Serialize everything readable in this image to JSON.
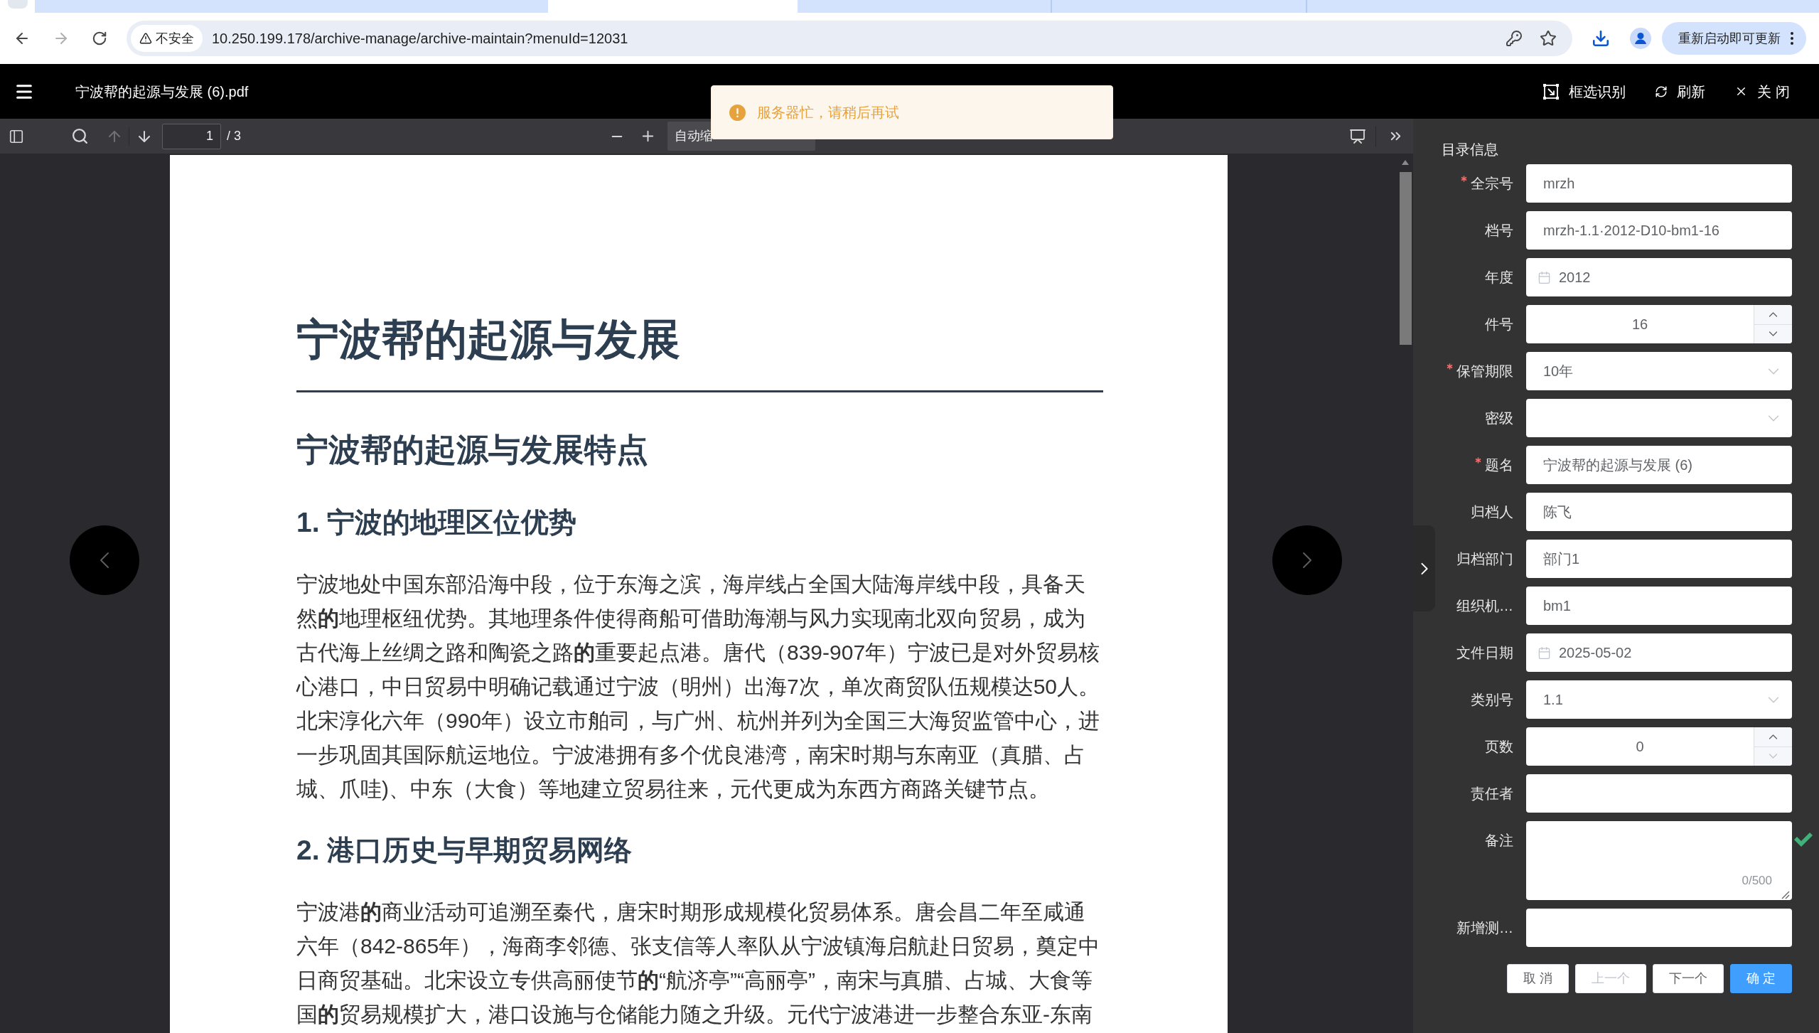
{
  "browser": {
    "tabs": [
      {
        "selected": false
      },
      {
        "selected": true
      },
      {
        "selected": false
      },
      {
        "selected": false
      },
      {
        "selected": false
      }
    ],
    "back_enabled": true,
    "forward_enabled": false,
    "security_label": "不安全",
    "url": "10.250.199.178/archive-manage/archive-maintain?menuId=12031",
    "update_label": "重新启动即可更新"
  },
  "header": {
    "title": "宁波帮的起源与发展 (6).pdf",
    "actions": [
      {
        "kind": "select-area",
        "label": "框选识别"
      },
      {
        "kind": "refresh",
        "label": "刷新"
      },
      {
        "kind": "close",
        "label": "关 闭"
      }
    ]
  },
  "toast": {
    "kind": "warning",
    "message": "服务器忙，请稍后再试"
  },
  "pdf_toolbar": {
    "page": "1",
    "page_total": "/ 3",
    "previous_disabled": true,
    "next_disabled": false,
    "zoom": "自动缩"
  },
  "document": {
    "title": "宁波帮的起源与发展",
    "blocks": [
      {
        "kind": "section",
        "text": "宁波帮的起源与发展特点"
      },
      {
        "kind": "subsection",
        "text": "1. 宁波的地理区位优势"
      },
      {
        "kind": "paragraph",
        "text": "宁波地处中国东部沿海中段，位于东海之滨，海岸线占全国大陆海岸线中段，具备天然**的**地理枢纽优势。其地理条件使得商船可借助海潮与风力实现南北双向贸易，成为古代海上丝绸之路和陶瓷之路**的**重要起点港。唐代（839-907年）宁波已是对外贸易核心港口，中日贸易中明确记载通过宁波（明州）出海7次，单次商贸队伍规模达50人。北宋淳化六年（990年）设立市舶司，与广州、杭州并列为全国三大海贸监管中心，进一步巩固其国际航运地位。宁波港拥有多个优良港湾，南宋时期与东南亚（真腊、占城、爪哇)、中东（大食）等地建立贸易往来，元代更成为东西方商路关键节点。"
      },
      {
        "kind": "subsection",
        "text": "2. 港口历史与早期贸易网络"
      },
      {
        "kind": "paragraph",
        "text": "宁波港**的**商业活动可追溯至秦代，唐宋时期形成规模化贸易体系。唐会昌二年至咸通六年（842-865年），海商李邻德、张支信等人率队从宁波镇海启航赴日贸易，奠定中日商贸基础。北宋设立专供高丽使节**的**“航济亭”“高丽亭”，南宋与真腊、占城、大食等国**的**贸易规模扩大，港口设施与仓储能力随之升级。元代宁波港进一步整合东亚-东南"
      }
    ]
  },
  "catalog": {
    "title": "目录信息",
    "fields": [
      {
        "label": "全宗号",
        "kind": "text",
        "required": true,
        "value": "mrzh",
        "validated": false
      },
      {
        "label": "档号",
        "kind": "text",
        "required": false,
        "value": "mrzh-1.1·2012-D10-bm1-16",
        "validated": false
      },
      {
        "label": "年度",
        "kind": "date",
        "required": false,
        "value": "2012",
        "validated": false
      },
      {
        "label": "件号",
        "kind": "number",
        "required": false,
        "value": "16",
        "decrease_disabled": false,
        "validated": false
      },
      {
        "label": "保管期限",
        "kind": "select",
        "required": true,
        "value": "10年",
        "validated": false
      },
      {
        "label": "密级",
        "kind": "select",
        "required": false,
        "validated": false
      },
      {
        "label": "题名",
        "kind": "text",
        "required": true,
        "value": "宁波帮的起源与发展 (6)",
        "validated": false
      },
      {
        "label": "归档人",
        "kind": "text",
        "required": false,
        "value": "陈飞",
        "validated": false
      },
      {
        "label": "归档部门",
        "kind": "text",
        "required": false,
        "value": "部门1",
        "validated": false
      },
      {
        "label": "组织机…",
        "kind": "text",
        "required": false,
        "value": "bm1",
        "validated": false
      },
      {
        "label": "文件日期",
        "kind": "date",
        "required": false,
        "value": "2025-05-02",
        "validated": false
      },
      {
        "label": "类别号",
        "kind": "select",
        "required": false,
        "value": "1.1",
        "validated": false
      },
      {
        "label": "页数",
        "kind": "number",
        "required": false,
        "value": "0",
        "decrease_disabled": true,
        "validated": false
      },
      {
        "label": "责任者",
        "kind": "text",
        "required": false,
        "validated": false
      },
      {
        "label": "备注",
        "kind": "textarea",
        "required": false,
        "counter": "0/500",
        "validated": true
      },
      {
        "label": "新增测…",
        "kind": "text",
        "required": false,
        "validated": false
      }
    ],
    "buttons": [
      {
        "label": "取 消",
        "kind": "default",
        "disabled": false
      },
      {
        "label": "上一个",
        "kind": "default",
        "disabled": true
      },
      {
        "label": "下一个",
        "kind": "default",
        "disabled": false
      },
      {
        "label": "确 定",
        "kind": "primary",
        "disabled": false
      }
    ]
  }
}
